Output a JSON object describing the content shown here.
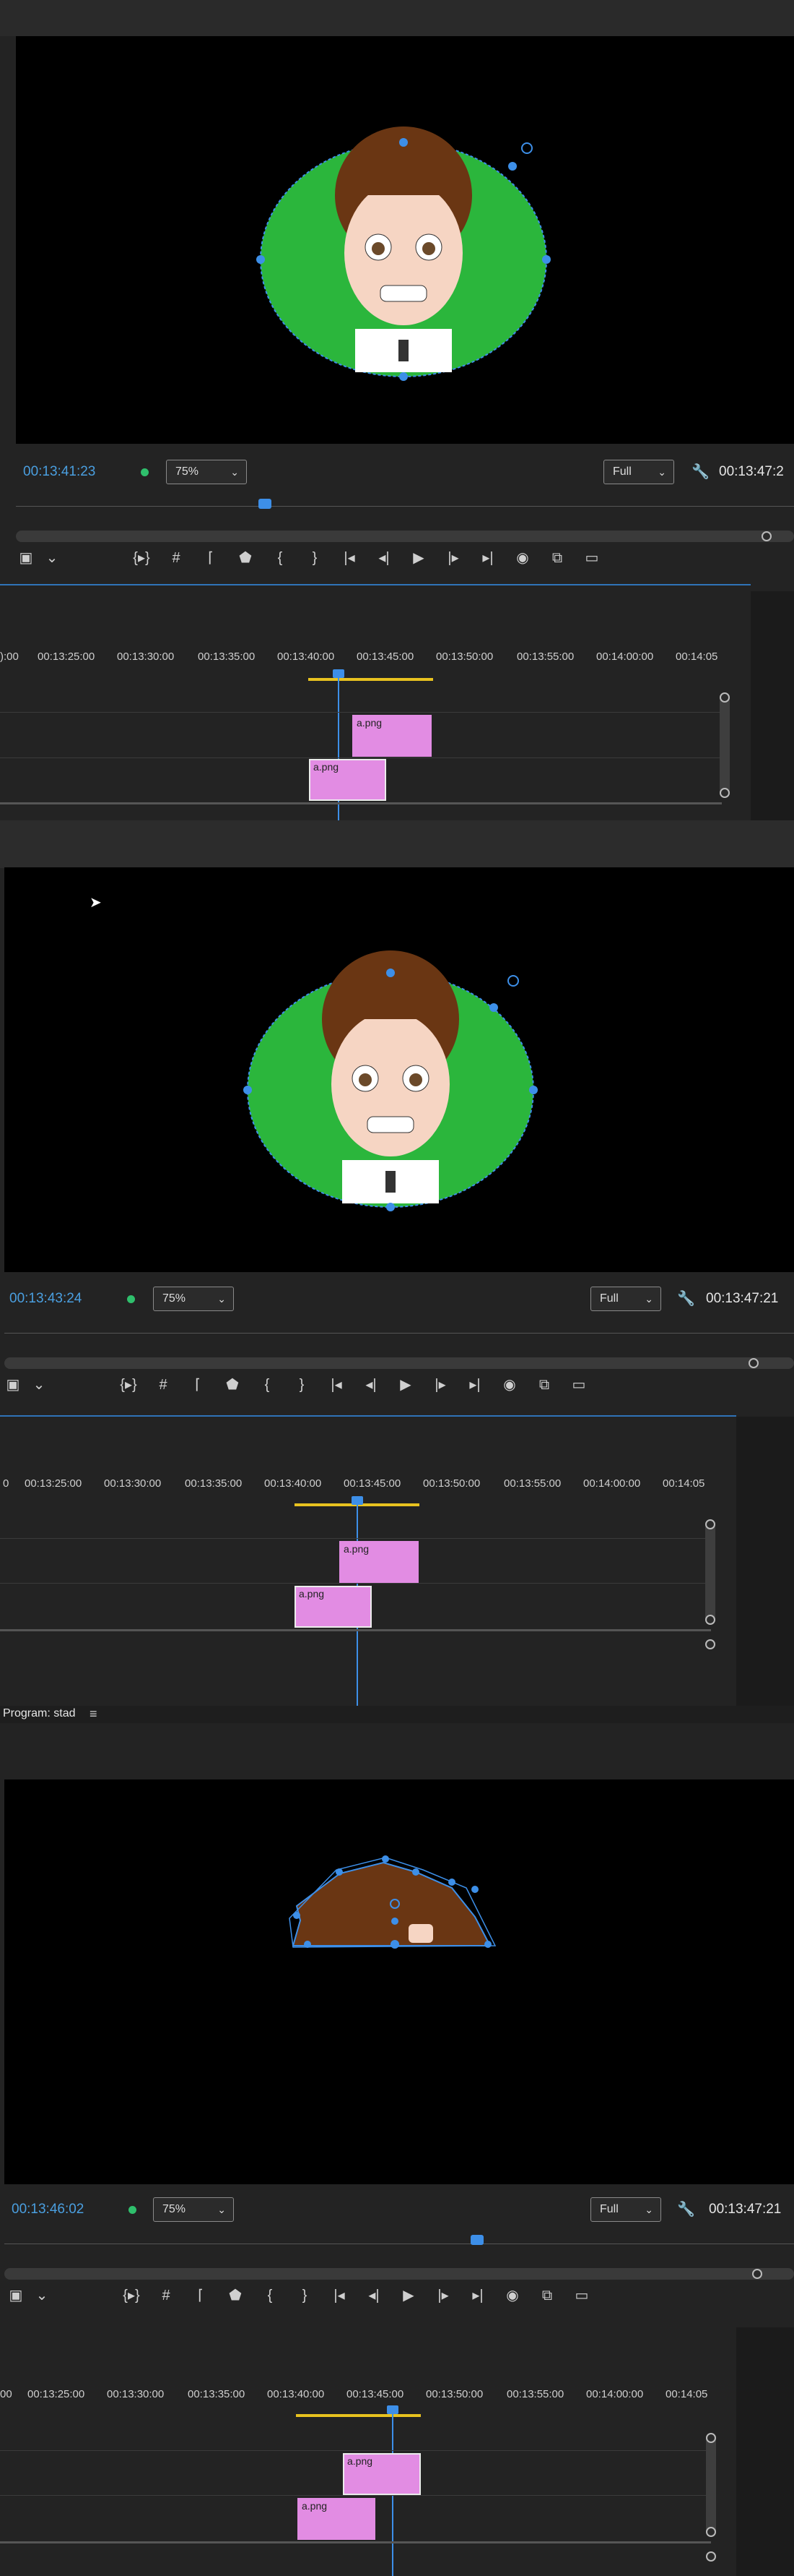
{
  "panels": [
    {
      "timecode": "00:13:41:23",
      "zoom": "75%",
      "quality": "Full",
      "duration": "00:13:47:2",
      "ruler": [
        "):00",
        "00:13:25:00",
        "00:13:30:00",
        "00:13:35:00",
        "00:13:40:00",
        "00:13:45:00",
        "00:13:50:00",
        "00:13:55:00",
        "00:14:00:00",
        "00:14:05"
      ],
      "clips": [
        {
          "label": "a.png"
        },
        {
          "label": "a.png"
        }
      ]
    },
    {
      "timecode": "00:13:43:24",
      "zoom": "75%",
      "quality": "Full",
      "duration": "00:13:47:21",
      "ruler": [
        "0",
        "00:13:25:00",
        "00:13:30:00",
        "00:13:35:00",
        "00:13:40:00",
        "00:13:45:00",
        "00:13:50:00",
        "00:13:55:00",
        "00:14:00:00",
        "00:14:05"
      ],
      "clips": [
        {
          "label": "a.png"
        },
        {
          "label": "a.png"
        }
      ]
    },
    {
      "title": "Program: stad",
      "menu_icon": "≡",
      "timecode": "00:13:46:02",
      "zoom": "75%",
      "quality": "Full",
      "duration": "00:13:47:21",
      "ruler": [
        "00",
        "00:13:25:00",
        "00:13:30:00",
        "00:13:35:00",
        "00:13:40:00",
        "00:13:45:00",
        "00:13:50:00",
        "00:13:55:00",
        "00:14:00:00",
        "00:14:05"
      ],
      "clips": [
        {
          "label": "a.png"
        },
        {
          "label": "a.png"
        }
      ]
    }
  ],
  "toolbar_icons": [
    "camera-settings-icon",
    "chevron-down-icon",
    "insert-edit-icon",
    "grid-icon",
    "trim-icon",
    "marker-icon",
    "mark-in-icon",
    "mark-out-icon",
    "go-to-in-icon",
    "step-back-icon",
    "play-icon",
    "step-forward-icon",
    "go-to-out-icon",
    "export-frame-icon",
    "comparison-view-icon",
    "safe-margins-icon"
  ],
  "toolbar_glyphs": [
    "▣",
    "⌄",
    "{▸}",
    "#",
    "⌈",
    "⬟",
    "{",
    "}",
    "|◂",
    "◂|",
    "▶",
    "|▸",
    "▸|",
    "◉",
    "⧉",
    "▭"
  ],
  "colors": {
    "accent": "#3d8fe8",
    "clip": "#e28ce3",
    "mask": "#2bb63c",
    "playhead": "#3d8fe8"
  }
}
